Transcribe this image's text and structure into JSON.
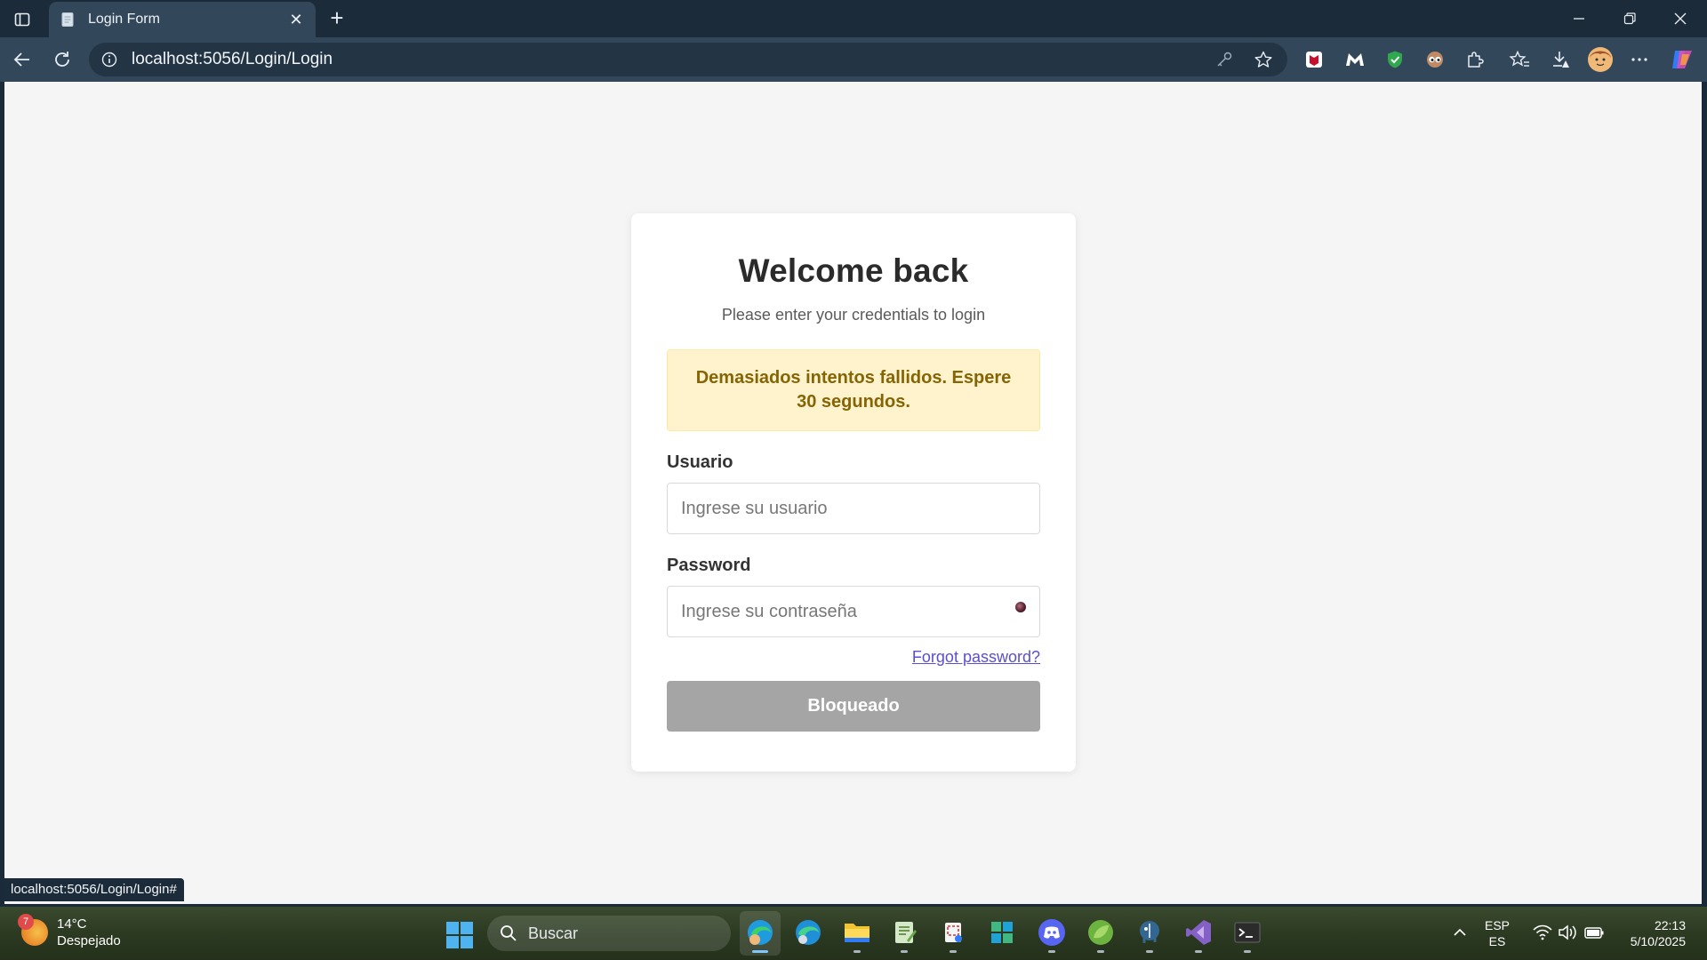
{
  "browser": {
    "tab_title": "Login Form",
    "tab_close": "✕",
    "new_tab": "+",
    "url": "localhost:5056/Login/Login",
    "status_url": "localhost:5056/Login/Login#"
  },
  "login": {
    "title": "Welcome back",
    "subtitle": "Please enter your credentials to login",
    "alert": "Demasiados intentos fallidos. Espere 30 segundos.",
    "username_label": "Usuario",
    "username_placeholder": "Ingrese su usuario",
    "username_value": "",
    "password_label": "Password",
    "password_placeholder": "Ingrese su contraseña",
    "password_value": "",
    "forgot_link": "Forgot password?",
    "submit_label": "Bloqueado",
    "submit_color": "#a5a5a5",
    "alert_bg": "#fff3cd",
    "alert_text_color": "#856404"
  },
  "taskbar": {
    "weather_badge": "7",
    "weather_temp": "14°C",
    "weather_desc": "Despejado",
    "search_label": "Buscar",
    "lang_top": "ESP",
    "lang_bottom": "ES",
    "time": "22:13",
    "date": "5/10/2025",
    "apps": [
      "edge-profile-icon",
      "edge-icon",
      "file-explorer-icon",
      "notepad-icon",
      "snipping-tool-icon",
      "app-grid-icon",
      "discord-icon",
      "spring-icon",
      "postgres-icon",
      "visual-studio-icon",
      "terminal-icon"
    ]
  }
}
